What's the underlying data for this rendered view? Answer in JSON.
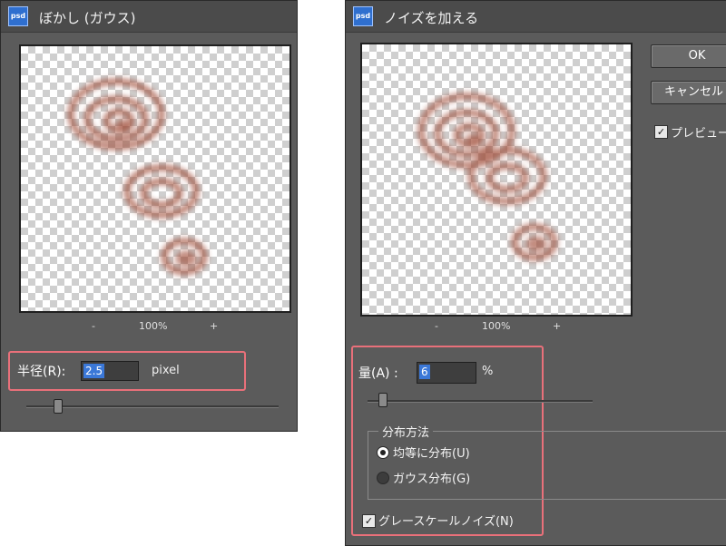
{
  "gaussian_dialog": {
    "app_icon": "psd",
    "title": "ぼかし (ガウス)",
    "zoom": {
      "minus": "-",
      "percent": "100%",
      "plus": "+"
    },
    "radius_label": "半径(R):",
    "radius_value": "2.5",
    "radius_unit": "pixel",
    "slider_level": 0.15
  },
  "noise_dialog": {
    "app_icon": "psd",
    "title": "ノイズを加える",
    "ok_label": "OK",
    "cancel_label": "キャンセル",
    "preview_label": "プレビュー",
    "preview_checked": true,
    "zoom": {
      "minus": "-",
      "percent": "100%",
      "plus": "+"
    },
    "amount_label": "量(A) :",
    "amount_value": "6",
    "amount_unit": "%",
    "slider_level": 0.06,
    "distribution": {
      "legend": "分布方法",
      "options": [
        {
          "label": "均等に分布(U)",
          "selected": true
        },
        {
          "label": "ガウス分布(G)",
          "selected": false
        }
      ]
    },
    "grayscale_label": "グレースケールノイズ(N)",
    "grayscale_checked": true
  },
  "colors": {
    "dialog_bg": "#5b5b5b",
    "highlight": "#e9707a",
    "swirl": "#9a3f2c",
    "input_selection": "#3b78d8"
  }
}
